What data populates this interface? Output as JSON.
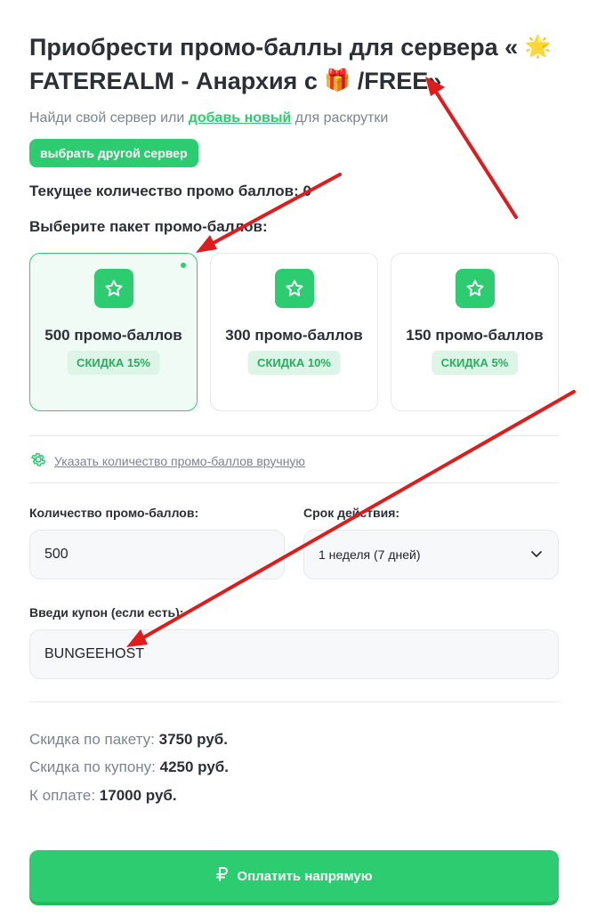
{
  "title": {
    "line1": "Приобрести промо-баллы для сервера « ",
    "emoji1": "🌟",
    "line2": " FATEREALM - Анархия с ",
    "emoji2": "🎁",
    "line3": " /FREE»"
  },
  "subtitle": {
    "before": "Найди свой сервер или ",
    "link": "добавь новый",
    "after": " для раскрутки"
  },
  "choose_server_button": "выбрать другой сервер",
  "current_points": "Текущее количество промо баллов: 0",
  "choose_package": "Выберите пакет промо-баллов:",
  "packages": [
    {
      "name": "500 промо-баллов",
      "discount": "СКИДКА 15%",
      "selected": true
    },
    {
      "name": "300 промо-баллов",
      "discount": "СКИДКА 10%",
      "selected": false
    },
    {
      "name": "150 промо-баллов",
      "discount": "СКИДКА 5%",
      "selected": false
    }
  ],
  "manual_link": "Указать количество промо-баллов вручную",
  "form": {
    "quantity_label": "Количество промо-баллов:",
    "quantity_value": "500",
    "duration_label": "Срок действия:",
    "duration_value": "1 неделя (7 дней)",
    "coupon_label": "Введи купон (если есть):",
    "coupon_value": "BUNGEEHOST"
  },
  "summary": {
    "package_discount_label": "Скидка по пакету:",
    "package_discount_value": "3750 руб.",
    "coupon_discount_label": "Скидка по купону:",
    "coupon_discount_value": "4250 руб.",
    "total_label": "К оплате:",
    "total_value": "17000 руб."
  },
  "pay_button": "Оплатить напрямую",
  "icons": [
    "star-icon",
    "gear-icon",
    "chevron-down-icon",
    "ruble-icon",
    "annotation-arrow"
  ],
  "colors": {
    "accent": "#2ecc71",
    "annotation": "#e01b1b"
  }
}
